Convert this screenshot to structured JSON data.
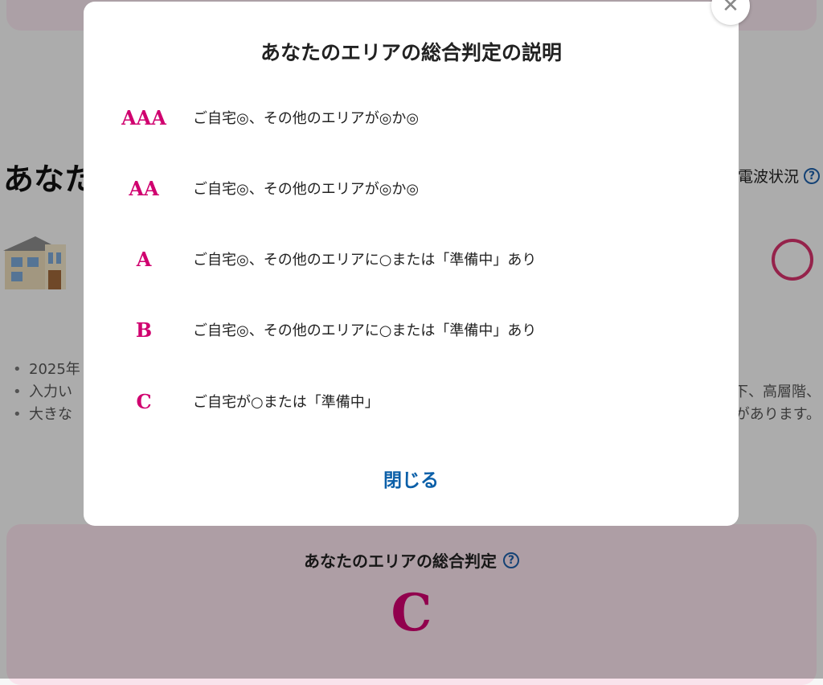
{
  "background": {
    "heading": "あなた",
    "signal_link_label": "電波状況",
    "notes": [
      {
        "left": "2025年",
        "right": ""
      },
      {
        "left": "入力い",
        "right": "下、高層階、"
      },
      {
        "left": "大きな",
        "right": "があります。"
      }
    ],
    "summary_title": "あなたのエリアの総合判定",
    "summary_grade": "C",
    "accent_color": "#d0006f",
    "link_color": "#0b5fa8"
  },
  "modal": {
    "title": "あなたのエリアの総合判定の説明",
    "rows": [
      {
        "grade": "AAA",
        "description": "ご自宅◎、その他のエリアが◎か◎"
      },
      {
        "grade": "AA",
        "description": "ご自宅◎、その他のエリアが◎か◎"
      },
      {
        "grade": "A",
        "description": "ご自宅◎、その他のエリアに○または「準備中」あり"
      },
      {
        "grade": "B",
        "description": "ご自宅◎、その他のエリアに○または「準備中」あり"
      },
      {
        "grade": "C",
        "description": "ご自宅が○または「準備中」"
      }
    ],
    "close_label": "閉じる",
    "close_icon": "close-icon"
  }
}
